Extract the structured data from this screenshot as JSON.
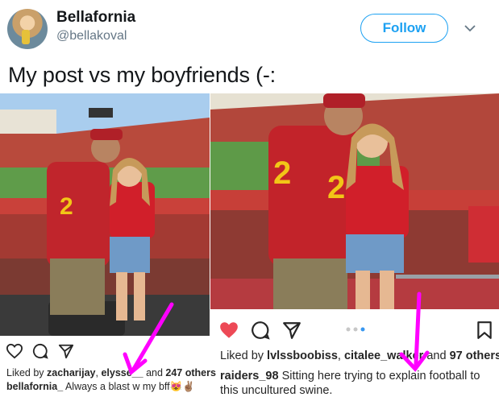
{
  "header": {
    "display_name": "Bellafornia",
    "handle": "@bellakoval",
    "follow_label": "Follow"
  },
  "tweet": {
    "text": "My post vs my boyfriends (-:"
  },
  "left_post": {
    "liked_prefix": "Liked by ",
    "liked_user1": "zacharijay",
    "liked_sep": ", ",
    "liked_user2": "elysse__",
    "liked_and": " and ",
    "liked_count": "247 others",
    "caption_user": "bellafornia_",
    "caption_text": " Always a blast w my bff😻✌🏽"
  },
  "right_post": {
    "liked_prefix": "Liked by ",
    "liked_user1": "lvlssboobiss",
    "liked_sep": ", ",
    "liked_user2": "citalee_walker",
    "liked_and": " and ",
    "liked_count": "97 others",
    "caption_user": "raiders_98",
    "caption_line1": " Sitting here trying to explain football to",
    "caption_line2": "this uncultured swine."
  },
  "icons": {
    "left": [
      "heart-outline-icon",
      "comment-icon",
      "share-icon"
    ],
    "right": [
      "heart-filled-icon",
      "comment-icon",
      "share-icon",
      "bookmark-icon"
    ]
  },
  "colors": {
    "follow_blue": "#1da1f2",
    "like_red": "#ed4956",
    "arrow_magenta": "#ff00ff",
    "carousel_active": "#3897f0"
  }
}
